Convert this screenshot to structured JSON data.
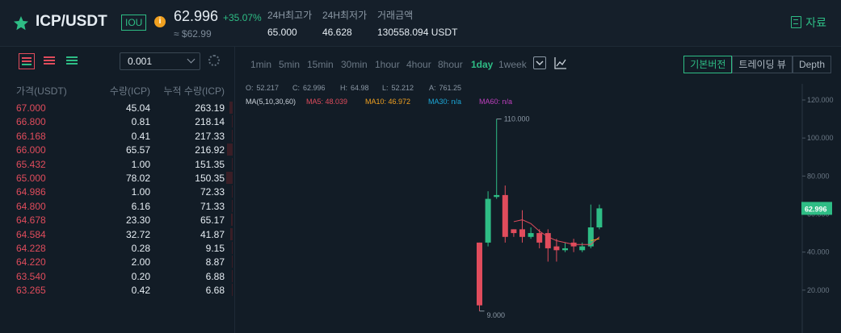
{
  "header": {
    "pair": "ICP/USDT",
    "badge": "IOU",
    "info_glyph": "i",
    "price": "62.996",
    "change": "+35.07%",
    "approx": "≈ $62.99",
    "stats": [
      {
        "label": "24H최고가",
        "value": "65.000"
      },
      {
        "label": "24H최저가",
        "value": "46.628"
      },
      {
        "label": "거래금액",
        "value": "130558.094 USDT"
      }
    ],
    "doc_label": "자료",
    "icons": [
      "star-icon",
      "info-icon",
      "document-icon"
    ]
  },
  "orderbook": {
    "precision": "0.001",
    "columns": [
      "가격(USDT)",
      "수량(ICP)",
      "누적 수량(ICP)"
    ],
    "rows": [
      {
        "price": "67.000",
        "qty": "45.04",
        "cum": "263.19"
      },
      {
        "price": "66.800",
        "qty": "0.81",
        "cum": "218.14"
      },
      {
        "price": "66.168",
        "qty": "0.41",
        "cum": "217.33"
      },
      {
        "price": "66.000",
        "qty": "65.57",
        "cum": "216.92"
      },
      {
        "price": "65.432",
        "qty": "1.00",
        "cum": "151.35"
      },
      {
        "price": "65.000",
        "qty": "78.02",
        "cum": "150.35"
      },
      {
        "price": "64.986",
        "qty": "1.00",
        "cum": "72.33"
      },
      {
        "price": "64.800",
        "qty": "6.16",
        "cum": "71.33"
      },
      {
        "price": "64.678",
        "qty": "23.30",
        "cum": "65.17"
      },
      {
        "price": "64.584",
        "qty": "32.72",
        "cum": "41.87"
      },
      {
        "price": "64.228",
        "qty": "0.28",
        "cum": "9.15"
      },
      {
        "price": "64.220",
        "qty": "2.00",
        "cum": "8.87"
      },
      {
        "price": "63.540",
        "qty": "0.20",
        "cum": "6.88"
      },
      {
        "price": "63.265",
        "qty": "0.42",
        "cum": "6.68"
      }
    ],
    "icons": [
      "both-sides-icon",
      "sells-only-icon",
      "buys-only-icon",
      "chevron-down-icon",
      "gear-icon"
    ]
  },
  "chart": {
    "timeframes": [
      "1min",
      "5min",
      "15min",
      "30min",
      "1hour",
      "4hour",
      "8hour",
      "1day",
      "1week"
    ],
    "active_timeframe": "1day",
    "view_buttons": [
      "기본버전",
      "트레이딩 뷰",
      "Depth"
    ],
    "active_view": "기본버전",
    "ohlc": [
      {
        "label": "O:",
        "value": "52.217"
      },
      {
        "label": "C:",
        "value": "62.996"
      },
      {
        "label": "H:",
        "value": "64.98"
      },
      {
        "label": "L:",
        "value": "52.212"
      },
      {
        "label": "A:",
        "value": "761.25"
      }
    ],
    "ma_label": "MA(5,10,30,60)",
    "ma": [
      {
        "label": "MA5: 48.039",
        "color": "#e04c5c"
      },
      {
        "label": "MA10: 46.972",
        "color": "#f0a020"
      },
      {
        "label": "MA30: n/a",
        "color": "#1ca8d8"
      },
      {
        "label": "MA60: n/a",
        "color": "#c040c0"
      }
    ],
    "current_price_tag": "62.996",
    "max_label": "110.000",
    "min_label": "9.000",
    "icons": [
      "dropdown-icon",
      "line-chart-icon"
    ]
  },
  "chart_data": {
    "type": "candlestick",
    "y_ticks": [
      "120.000",
      "100.000",
      "80.000",
      "60.000",
      "40.000",
      "20.000"
    ],
    "ylim": [
      0,
      120
    ],
    "up_color": "#2ebd85",
    "down_color": "#e04c5c",
    "candles": [
      {
        "o": 45,
        "h": 45,
        "l": 9,
        "c": 12
      },
      {
        "o": 45,
        "h": 72,
        "l": 43,
        "c": 68
      },
      {
        "o": 69,
        "h": 110,
        "l": 68,
        "c": 70
      },
      {
        "o": 70,
        "h": 75,
        "l": 45,
        "c": 48
      },
      {
        "o": 52,
        "h": 52,
        "l": 48,
        "c": 50
      },
      {
        "o": 52,
        "h": 62,
        "l": 45,
        "c": 48
      },
      {
        "o": 48,
        "h": 53,
        "l": 47,
        "c": 50
      },
      {
        "o": 50,
        "h": 52,
        "l": 42,
        "c": 45
      },
      {
        "o": 50,
        "h": 52,
        "l": 35,
        "c": 42
      },
      {
        "o": 43,
        "h": 47,
        "l": 35,
        "c": 41
      },
      {
        "o": 41,
        "h": 45,
        "l": 40,
        "c": 42
      },
      {
        "o": 45,
        "h": 47,
        "l": 40,
        "c": 43
      },
      {
        "o": 41,
        "h": 45,
        "l": 40,
        "c": 43
      },
      {
        "o": 43,
        "h": 65,
        "l": 42,
        "c": 53
      },
      {
        "o": 53,
        "h": 65,
        "l": 52,
        "c": 63
      }
    ],
    "ma5": [
      null,
      null,
      null,
      null,
      56,
      57,
      55,
      51,
      48,
      46,
      45,
      44,
      44,
      44,
      48
    ],
    "ma10": [
      null,
      null,
      null,
      null,
      null,
      null,
      null,
      null,
      null,
      null,
      null,
      null,
      null,
      46,
      47
    ]
  }
}
